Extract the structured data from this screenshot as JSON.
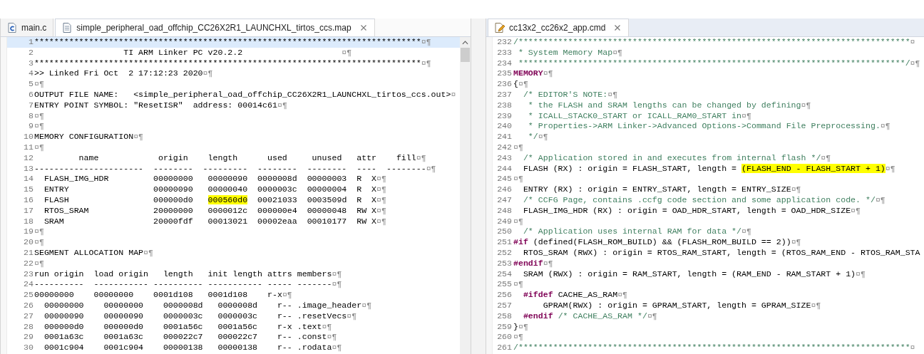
{
  "editors": [
    {
      "tabs": [
        {
          "label": "main.c",
          "kind": "c-source",
          "selected": false
        },
        {
          "label": "simple_peripheral_oad_offchip_CC26X2R1_LAUNCHXL_tirtos_ccs.map",
          "kind": "text",
          "selected": true
        }
      ],
      "vertical_scrollbar": true,
      "lines": [
        {
          "number": "1",
          "current": true,
          "segments": [
            {
              "kind": "code",
              "text": "******************************************************************************"
            }
          ],
          "eol": "¤¶"
        },
        {
          "number": "2",
          "current": false,
          "segments": [
            {
              "kind": "code",
              "text": "                  TI ARM Linker PC v20.2.2                    "
            }
          ],
          "eol": "¤¶"
        },
        {
          "number": "3",
          "current": false,
          "segments": [
            {
              "kind": "code",
              "text": "******************************************************************************"
            }
          ],
          "eol": "¤¶"
        },
        {
          "number": "4",
          "current": false,
          "segments": [
            {
              "kind": "code",
              "text": ">> Linked Fri Oct  2 17:12:23 2020"
            }
          ],
          "eol": "¤¶"
        },
        {
          "number": "5",
          "current": false,
          "eol": "¤¶"
        },
        {
          "number": "6",
          "current": false,
          "segments": [
            {
              "kind": "code",
              "text": "OUTPUT FILE NAME:   <simple_peripheral_oad_offchip_CC26X2R1_LAUNCHXL_tirtos_ccs.out>"
            }
          ],
          "eol": "¤"
        },
        {
          "number": "7",
          "current": false,
          "segments": [
            {
              "kind": "code",
              "text": "ENTRY POINT SYMBOL: \"ResetISR\"  address: 00014c61"
            }
          ],
          "eol": "¤¶"
        },
        {
          "number": "8",
          "current": false,
          "eol": "¤¶"
        },
        {
          "number": "9",
          "current": false,
          "eol": "¤¶"
        },
        {
          "number": "10",
          "current": false,
          "segments": [
            {
              "kind": "code",
              "text": "MEMORY CONFIGURATION"
            }
          ],
          "eol": "¤¶"
        },
        {
          "number": "11",
          "current": false,
          "eol": "¤¶"
        },
        {
          "number": "12",
          "current": false,
          "segments": [
            {
              "kind": "code",
              "text": "         name            origin    length      used     unused   attr    fill"
            }
          ],
          "eol": "¤¶"
        },
        {
          "number": "13",
          "current": false,
          "segments": [
            {
              "kind": "code",
              "text": "----------------------  --------  ---------  --------  --------  ----  --------"
            }
          ],
          "eol": "¤¶"
        },
        {
          "number": "14",
          "current": false,
          "segments": [
            {
              "kind": "code",
              "text": "  FLASH_IMG_HDR         00000000   00000090  0000008d  00000003  R  X"
            }
          ],
          "eol": "¤¶"
        },
        {
          "number": "15",
          "current": false,
          "segments": [
            {
              "kind": "code",
              "text": "  ENTRY                 00000090   00000040  0000003c  00000004  R  X"
            }
          ],
          "eol": "¤¶"
        },
        {
          "number": "16",
          "current": false,
          "segments": [
            {
              "kind": "code",
              "text": "  FLASH                 000000d0   "
            },
            {
              "kind": "highlight",
              "text": "000560d0"
            },
            {
              "kind": "code",
              "text": "  00021033  0003509d  R  X"
            }
          ],
          "eol": "¤¶"
        },
        {
          "number": "17",
          "current": false,
          "segments": [
            {
              "kind": "code",
              "text": "  RTOS_SRAM             20000000   0000012c  000000e4  00000048  RW X"
            }
          ],
          "eol": "¤¶"
        },
        {
          "number": "18",
          "current": false,
          "segments": [
            {
              "kind": "code",
              "text": "  SRAM                  20000fdf   00013021  00002eaa  00010177  RW X"
            }
          ],
          "eol": "¤¶"
        },
        {
          "number": "19",
          "current": false,
          "eol": "¤¶"
        },
        {
          "number": "20",
          "current": false,
          "eol": "¤¶"
        },
        {
          "number": "21",
          "current": false,
          "segments": [
            {
              "kind": "code",
              "text": "SEGMENT ALLOCATION MAP"
            }
          ],
          "eol": "¤¶"
        },
        {
          "number": "22",
          "current": false,
          "eol": "¤¶"
        },
        {
          "number": "23",
          "current": false,
          "segments": [
            {
              "kind": "code",
              "text": "run origin  load origin   length   init length attrs members"
            }
          ],
          "eol": "¤¶"
        },
        {
          "number": "24",
          "current": false,
          "segments": [
            {
              "kind": "code",
              "text": "----------  ----------- ---------- ----------- ----- -------"
            }
          ],
          "eol": "¤¶"
        },
        {
          "number": "25",
          "current": false,
          "segments": [
            {
              "kind": "code",
              "text": "00000000    00000000    0001d108   0001d108    r-x"
            }
          ],
          "eol": "¤¶"
        },
        {
          "number": "26",
          "current": false,
          "segments": [
            {
              "kind": "code",
              "text": "  00000000    00000000    0000008d   0000008d    r-- .image_header"
            }
          ],
          "eol": "¤¶"
        },
        {
          "number": "27",
          "current": false,
          "segments": [
            {
              "kind": "code",
              "text": "  00000090    00000090    0000003c   0000003c    r-- .resetVecs"
            }
          ],
          "eol": "¤¶"
        },
        {
          "number": "28",
          "current": false,
          "segments": [
            {
              "kind": "code",
              "text": "  000000d0    000000d0    0001a56c   0001a56c    r-x .text"
            }
          ],
          "eol": "¤¶"
        },
        {
          "number": "29",
          "current": false,
          "segments": [
            {
              "kind": "code",
              "text": "  0001a63c    0001a63c    000022c7   000022c7    r-- .const"
            }
          ],
          "eol": "¤¶"
        },
        {
          "number": "30",
          "current": false,
          "segments": [
            {
              "kind": "code",
              "text": "  0001c904    0001c904    00000138   00000138    r-- .rodata"
            }
          ],
          "eol": "¤¶"
        }
      ]
    },
    {
      "tabs": [
        {
          "label": "cc13x2_cc26x2_app.cmd",
          "kind": "linker-command",
          "selected": true
        }
      ],
      "lines": [
        {
          "number": "232",
          "current": false,
          "segments": [
            {
              "kind": "comment",
              "text": "/*******************************************************************************"
            }
          ],
          "eol": "¤"
        },
        {
          "number": "233",
          "current": false,
          "segments": [
            {
              "kind": "comment",
              "text": " * System Memory Map"
            }
          ],
          "eol": "¤¶"
        },
        {
          "number": "234",
          "current": false,
          "segments": [
            {
              "kind": "comment",
              "text": " ******************************************************************************/"
            }
          ],
          "eol": "¤¶"
        },
        {
          "number": "235",
          "current": false,
          "segments": [
            {
              "kind": "keyword",
              "text": "MEMORY"
            }
          ],
          "eol": "¤¶"
        },
        {
          "number": "236",
          "current": false,
          "segments": [
            {
              "kind": "code",
              "text": "{"
            }
          ],
          "eol": "¤¶"
        },
        {
          "number": "237",
          "current": false,
          "segments": [
            {
              "kind": "comment",
              "text": "  /* EDITOR'S NOTE:"
            }
          ],
          "eol": "¤¶"
        },
        {
          "number": "238",
          "current": false,
          "segments": [
            {
              "kind": "comment",
              "text": "   * the FLASH and SRAM lengths can be changed by defining"
            }
          ],
          "eol": "¤¶"
        },
        {
          "number": "239",
          "current": false,
          "segments": [
            {
              "kind": "comment",
              "text": "   * ICALL_STACK0_START or ICALL_RAM0_START in"
            }
          ],
          "eol": "¤¶"
        },
        {
          "number": "240",
          "current": false,
          "segments": [
            {
              "kind": "comment",
              "text": "   * Properties->ARM Linker->Advanced Options->Command File Preprocessing."
            }
          ],
          "eol": "¤¶"
        },
        {
          "number": "241",
          "current": false,
          "segments": [
            {
              "kind": "comment",
              "text": "   */"
            }
          ],
          "eol": "¤¶"
        },
        {
          "number": "242",
          "current": false,
          "eol": "¤¶"
        },
        {
          "number": "243",
          "current": false,
          "segments": [
            {
              "kind": "comment",
              "text": "  /* Application stored in and executes from internal flash */"
            }
          ],
          "eol": "¤¶"
        },
        {
          "number": "244",
          "current": false,
          "segments": [
            {
              "kind": "code",
              "text": "  FLASH (RX) : origin = FLASH_START, length = "
            },
            {
              "kind": "highlight",
              "text": "(FLASH_END - FLASH_START + 1)"
            }
          ],
          "eol": "¤¶"
        },
        {
          "number": "245",
          "current": false,
          "eol": "¤¶"
        },
        {
          "number": "246",
          "current": false,
          "segments": [
            {
              "kind": "code",
              "text": "  ENTRY (RX) : origin = ENTRY_START, length = ENTRY_SIZE"
            }
          ],
          "eol": "¤¶"
        },
        {
          "number": "247",
          "current": false,
          "segments": [
            {
              "kind": "comment",
              "text": "  /* CCFG Page, contains .ccfg code section and some application code. */"
            }
          ],
          "eol": "¤¶"
        },
        {
          "number": "248",
          "current": false,
          "segments": [
            {
              "kind": "code",
              "text": "  FLASH_IMG_HDR (RX) : origin = OAD_HDR_START, length = OAD_HDR_SIZE"
            }
          ],
          "eol": "¤¶"
        },
        {
          "number": "249",
          "current": false,
          "eol": "¤¶"
        },
        {
          "number": "250",
          "current": false,
          "segments": [
            {
              "kind": "comment",
              "text": "  /* Application uses internal RAM for data */"
            }
          ],
          "eol": "¤¶"
        },
        {
          "number": "251",
          "current": false,
          "segments": [
            {
              "kind": "keyword",
              "text": "#if"
            },
            {
              "kind": "code",
              "text": " (defined(FLASH_ROM_BUILD) && (FLASH_ROM_BUILD == 2))"
            }
          ],
          "eol": "¤¶"
        },
        {
          "number": "252",
          "current": false,
          "segments": [
            {
              "kind": "code",
              "text": "  RTOS_SRAM (RWX) : origin = RTOS_RAM_START, length = (RTOS_RAM_END - RTOS_RAM_STA"
            }
          ]
        },
        {
          "number": "253",
          "current": false,
          "segments": [
            {
              "kind": "keyword",
              "text": "#endif"
            }
          ],
          "eol": "¤¶"
        },
        {
          "number": "254",
          "current": false,
          "segments": [
            {
              "kind": "code",
              "text": "  SRAM (RWX) : origin = RAM_START, length = (RAM_END - RAM_START + 1)"
            }
          ],
          "eol": "¤¶"
        },
        {
          "number": "255",
          "current": false,
          "eol": "¤¶"
        },
        {
          "number": "256",
          "current": false,
          "segments": [
            {
              "kind": "keyword",
              "text": "  #ifdef"
            },
            {
              "kind": "code",
              "text": " CACHE_AS_RAM"
            }
          ],
          "eol": "¤¶"
        },
        {
          "number": "257",
          "current": false,
          "segments": [
            {
              "kind": "code",
              "text": "      GPRAM(RWX) : origin = GPRAM_START, length = GPRAM_SIZE"
            }
          ],
          "eol": "¤¶"
        },
        {
          "number": "258",
          "current": false,
          "segments": [
            {
              "kind": "keyword",
              "text": "  #endif"
            },
            {
              "kind": "comment",
              "text": " /* CACHE_AS_RAM */"
            }
          ],
          "eol": "¤¶"
        },
        {
          "number": "259",
          "current": false,
          "segments": [
            {
              "kind": "code",
              "text": "}"
            }
          ],
          "eol": "¤¶"
        },
        {
          "number": "260",
          "current": false,
          "eol": "¤¶"
        },
        {
          "number": "261",
          "current": false,
          "segments": [
            {
              "kind": "comment",
              "text": "/*******************************************************************************"
            }
          ],
          "eol": "¤"
        }
      ]
    }
  ]
}
